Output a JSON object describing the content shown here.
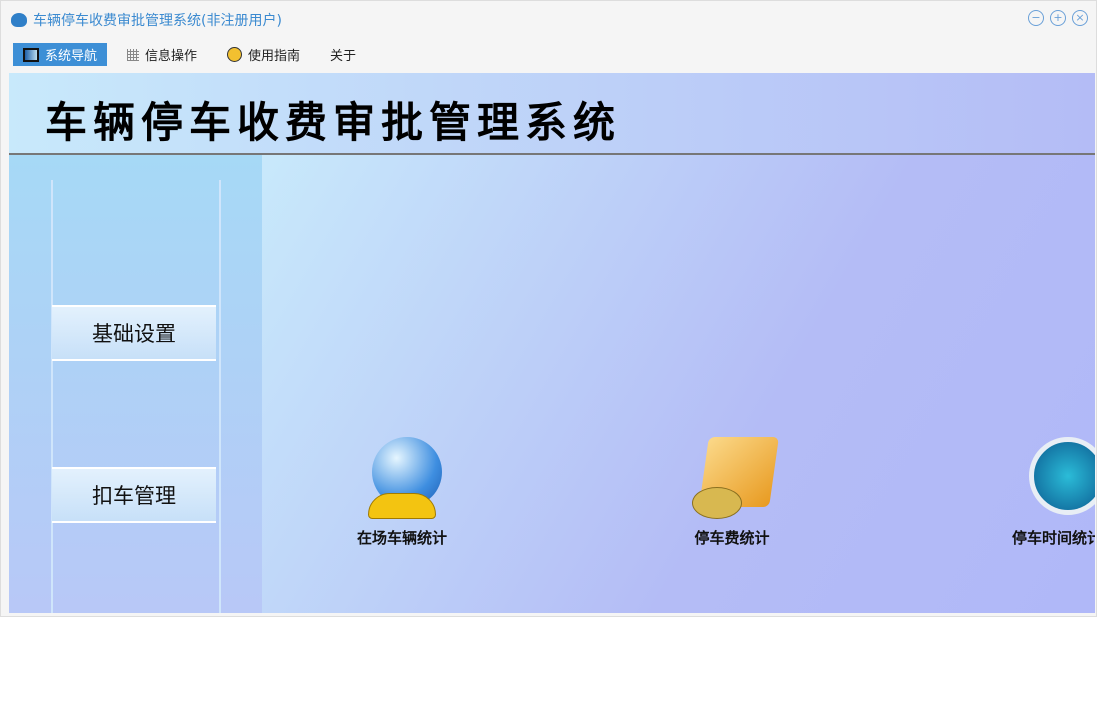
{
  "window": {
    "title": "车辆停车收费审批管理系统(非注册用户)",
    "controls": [
      "minimize",
      "maximize",
      "close"
    ]
  },
  "menu": [
    {
      "label": "系统导航",
      "icon": "monitor-icon",
      "active": true
    },
    {
      "label": "信息操作",
      "icon": "grid-icon"
    },
    {
      "label": "使用指南",
      "icon": "help-icon"
    },
    {
      "label": "关于"
    }
  ],
  "banner": {
    "title": "车辆停车收费审批管理系统"
  },
  "sidebar": {
    "items": [
      {
        "label": "基础设置"
      },
      {
        "label": "扣车管理"
      }
    ]
  },
  "tiles": [
    {
      "label": "在场车辆统计",
      "icon": "globe-car-icon"
    },
    {
      "label": "停车费统计",
      "icon": "folder-coins-icon"
    },
    {
      "label": "停车时间统计",
      "icon": "clock-icon"
    }
  ]
}
